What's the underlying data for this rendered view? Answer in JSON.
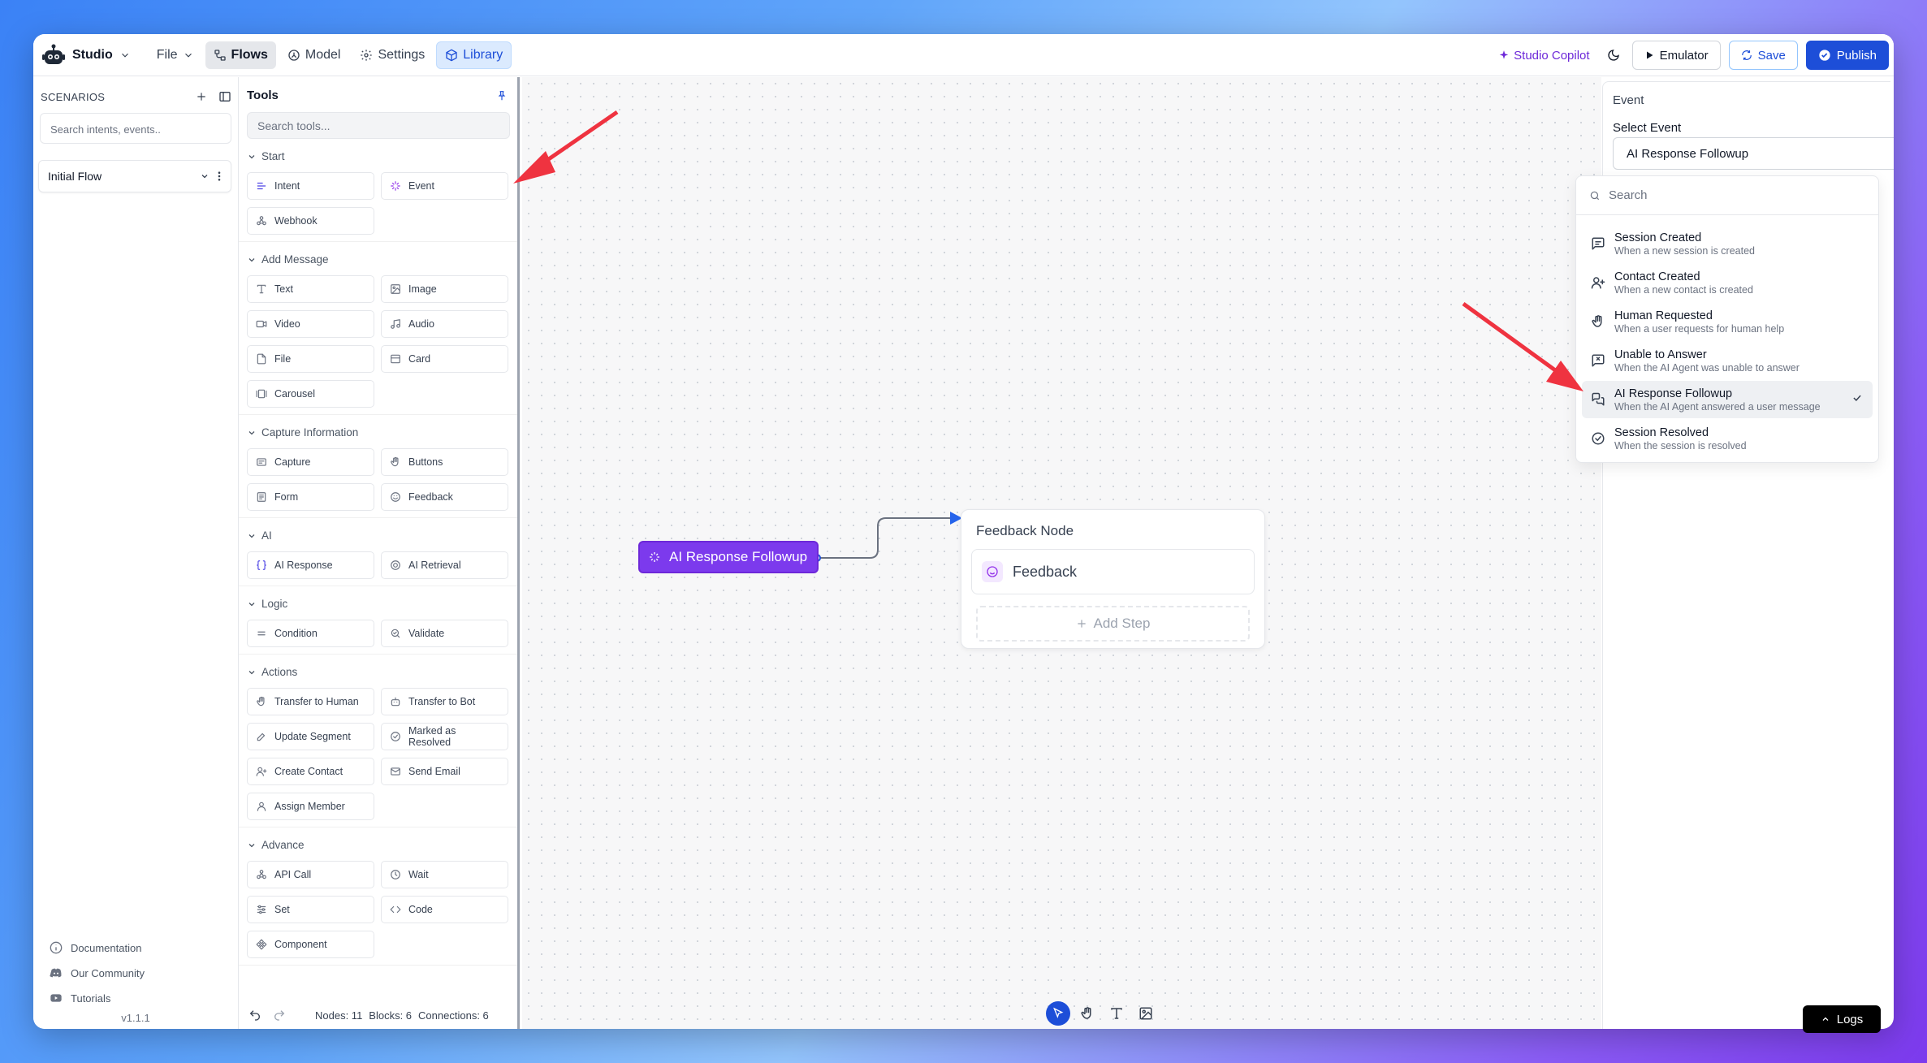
{
  "app": {
    "name": "Studio"
  },
  "menu": {
    "file": "File",
    "flows": "Flows",
    "model": "Model",
    "settings": "Settings",
    "library": "Library"
  },
  "topright": {
    "copilot": "Studio Copilot",
    "emulator": "Emulator",
    "save": "Save",
    "publish": "Publish"
  },
  "scenarios": {
    "header": "SCENARIOS",
    "search_placeholder": "Search intents, events..",
    "flow": "Initial Flow"
  },
  "links": {
    "docs": "Documentation",
    "community": "Our Community",
    "tutorials": "Tutorials",
    "version": "v1.1.1"
  },
  "tools": {
    "header": "Tools",
    "search_placeholder": "Search tools...",
    "sections": [
      {
        "title": "Start",
        "items": [
          {
            "label": "Intent",
            "icon": "intent-icon"
          },
          {
            "label": "Event",
            "icon": "sparkle-icon"
          },
          {
            "label": "Webhook",
            "icon": "webhook-icon"
          }
        ]
      },
      {
        "title": "Add Message",
        "items": [
          {
            "label": "Text",
            "icon": "text-icon"
          },
          {
            "label": "Image",
            "icon": "image-icon"
          },
          {
            "label": "Video",
            "icon": "video-icon"
          },
          {
            "label": "Audio",
            "icon": "audio-icon"
          },
          {
            "label": "File",
            "icon": "file-icon"
          },
          {
            "label": "Card",
            "icon": "card-icon"
          },
          {
            "label": "Carousel",
            "icon": "carousel-icon"
          }
        ]
      },
      {
        "title": "Capture Information",
        "items": [
          {
            "label": "Capture",
            "icon": "capture-icon"
          },
          {
            "label": "Buttons",
            "icon": "pointer-icon"
          },
          {
            "label": "Form",
            "icon": "form-icon"
          },
          {
            "label": "Feedback",
            "icon": "smile-icon"
          }
        ]
      },
      {
        "title": "AI",
        "items": [
          {
            "label": "AI Response",
            "icon": "braces-icon"
          },
          {
            "label": "AI Retrieval",
            "icon": "retrieval-icon"
          }
        ]
      },
      {
        "title": "Logic",
        "items": [
          {
            "label": "Condition",
            "icon": "equals-icon"
          },
          {
            "label": "Validate",
            "icon": "validate-icon"
          }
        ]
      },
      {
        "title": "Actions",
        "items": [
          {
            "label": "Transfer to Human",
            "icon": "hand-icon"
          },
          {
            "label": "Transfer to Bot",
            "icon": "bot-icon"
          },
          {
            "label": "Update Segment",
            "icon": "edit-icon"
          },
          {
            "label": "Marked as Resolved",
            "icon": "check-circle-icon"
          },
          {
            "label": "Create Contact",
            "icon": "user-plus-icon"
          },
          {
            "label": "Send Email",
            "icon": "mail-icon"
          },
          {
            "label": "Assign Member",
            "icon": "user-icon"
          }
        ]
      },
      {
        "title": "Advance",
        "items": [
          {
            "label": "API Call",
            "icon": "api-icon"
          },
          {
            "label": "Wait",
            "icon": "clock-icon"
          },
          {
            "label": "Set",
            "icon": "sliders-icon"
          },
          {
            "label": "Code",
            "icon": "code-icon"
          },
          {
            "label": "Component",
            "icon": "component-icon"
          }
        ]
      }
    ]
  },
  "stats": {
    "nodes": "Nodes: 11",
    "blocks": "Blocks: 6",
    "connections": "Connections: 6"
  },
  "canvas": {
    "event_node": "AI Response Followup",
    "feedback_node": {
      "title": "Feedback Node",
      "step": "Feedback",
      "add": "Add Step"
    }
  },
  "panel": {
    "title": "Event",
    "label": "Select Event",
    "selected": "AI Response Followup",
    "search_placeholder": "Search",
    "options": [
      {
        "title": "Session Created",
        "desc": "When a new session is created",
        "icon": "message-square-icon"
      },
      {
        "title": "Contact Created",
        "desc": "When a new contact is created",
        "icon": "user-plus-icon"
      },
      {
        "title": "Human Requested",
        "desc": "When a user requests for human help",
        "icon": "hand-icon"
      },
      {
        "title": "Unable to Answer",
        "desc": "When the AI Agent was unable to answer",
        "icon": "message-x-icon"
      },
      {
        "title": "AI Response Followup",
        "desc": "When the AI Agent answered a user message",
        "icon": "messages-icon",
        "selected": true
      },
      {
        "title": "Session Resolved",
        "desc": "When the session is resolved",
        "icon": "check-circle-icon"
      }
    ]
  },
  "logs": "Logs",
  "colors": {
    "accent": "#1d4ed8",
    "event_node": "#7c3aed",
    "arrow": "#ef3340"
  }
}
